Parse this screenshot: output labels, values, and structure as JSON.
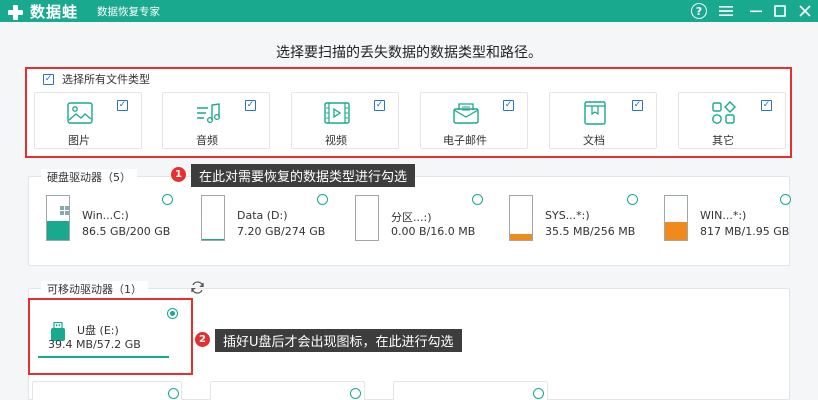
{
  "app": {
    "logo_text": "数据蛙",
    "subtitle": "数据恢复专家"
  },
  "heading": "选择要扫描的丢失数据的数据类型和路径。",
  "file_types": {
    "select_all_label": "选择所有文件类型",
    "items": [
      {
        "label": "图片",
        "icon": "image-icon",
        "checked": true
      },
      {
        "label": "音频",
        "icon": "audio-icon",
        "checked": true
      },
      {
        "label": "视频",
        "icon": "video-icon",
        "checked": true
      },
      {
        "label": "电子邮件",
        "icon": "email-icon",
        "checked": true
      },
      {
        "label": "文档",
        "icon": "document-icon",
        "checked": true
      },
      {
        "label": "其它",
        "icon": "other-icon",
        "checked": true
      }
    ]
  },
  "hard_drives": {
    "title": "硬盘驱动器（5）",
    "items": [
      {
        "name": "Win...C:)",
        "size": "86.5 GB/200 GB",
        "fill_fraction": 0.43,
        "fill_color": "#19a98e"
      },
      {
        "name": "Data (D:)",
        "size": "7.20 GB/274 GB",
        "fill_fraction": 0.03,
        "fill_color": "#19a98e"
      },
      {
        "name": "分区...:)",
        "size": "0.00 B/16.0 MB",
        "fill_fraction": 0.0,
        "fill_color": "#f08a1c"
      },
      {
        "name": "SYS...*:)",
        "size": "35.5 MB/256 MB",
        "fill_fraction": 0.14,
        "fill_color": "#f08a1c"
      },
      {
        "name": "WIN...*:)",
        "size": "817 MB/1.95 GB",
        "fill_fraction": 0.42,
        "fill_color": "#f08a1c"
      }
    ]
  },
  "removable_drives": {
    "title": "可移动驱动器（1）",
    "refresh_icon": "refresh-icon",
    "items": [
      {
        "name": "U盘 (E:)",
        "size": "39.4 MB/57.2 GB",
        "selected": true
      }
    ]
  },
  "callouts": [
    {
      "number": "1",
      "text": "在此对需要恢复的数据类型进行勾选"
    },
    {
      "number": "2",
      "text": "插好U盘后才会出现图标，在此进行勾选"
    }
  ],
  "colors": {
    "titlebar": "#19a98e",
    "highlight": "#e5302f",
    "checkbox": "#2a6fd6"
  }
}
